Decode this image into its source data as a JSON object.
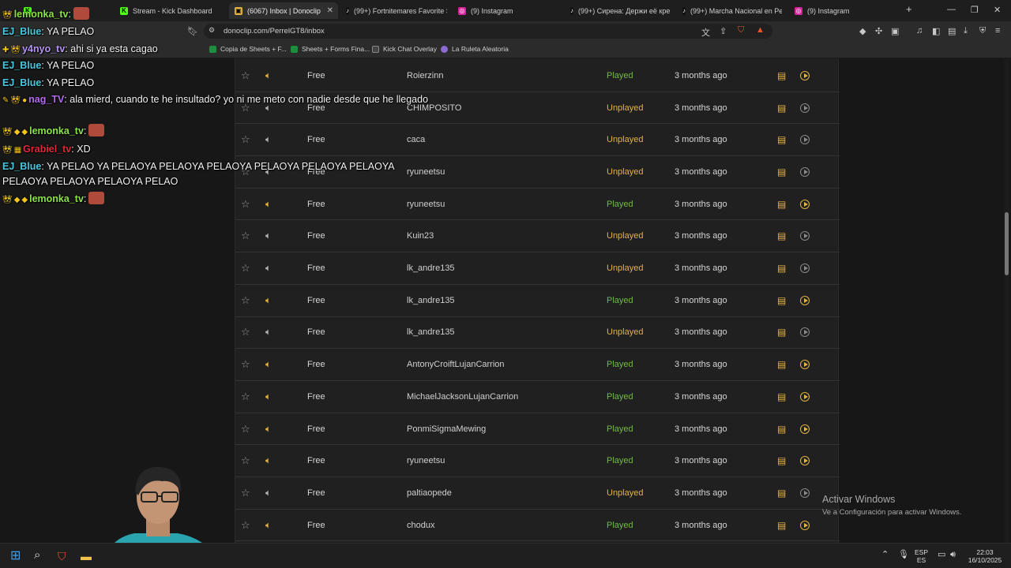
{
  "tabs": [
    {
      "title": "",
      "icon": "kick-icon"
    },
    {
      "title": "Stream - Kick Dashboard",
      "icon": "kick-icon"
    },
    {
      "title": "(6067) Inbox | Donoclip",
      "icon": "donoclip-icon",
      "active": true
    },
    {
      "title": "(99+) Fortnitemares Favorite Sk",
      "icon": "tiktok-icon"
    },
    {
      "title": "(9) Instagram",
      "icon": "instagram-icon"
    },
    {
      "title": "(99+) Сирена: Держи её крепк",
      "icon": "tiktok-icon"
    },
    {
      "title": "(99+) Marcha Nacional en Perú",
      "icon": "tiktok-icon"
    },
    {
      "title": "(9) Instagram",
      "icon": "instagram-icon"
    }
  ],
  "toolbar": {
    "url": "donoclip.com/PerrelGT8/inbox"
  },
  "bookmarks": [
    {
      "label": "Copia de Sheets + F...",
      "color": "#1e8e3e"
    },
    {
      "label": "Sheets + Forms Fina...",
      "color": "#1e8e3e"
    },
    {
      "label": "Kick Chat Overlay",
      "color": "#2a2a2a"
    },
    {
      "label": "La Ruleta Aleatoria",
      "color": "#8c6bd1"
    }
  ],
  "inbox": {
    "rows": [
      {
        "tier": "Free",
        "sender": "Roierzinn",
        "status": "Played",
        "when": "3 months ago"
      },
      {
        "tier": "Free",
        "sender": "CHIMPOSITO",
        "status": "Unplayed",
        "when": "3 months ago"
      },
      {
        "tier": "Free",
        "sender": "caca",
        "status": "Unplayed",
        "when": "3 months ago"
      },
      {
        "tier": "Free",
        "sender": "ryuneetsu",
        "status": "Unplayed",
        "when": "3 months ago"
      },
      {
        "tier": "Free",
        "sender": "ryuneetsu",
        "status": "Played",
        "when": "3 months ago"
      },
      {
        "tier": "Free",
        "sender": "Kuin23",
        "status": "Unplayed",
        "when": "3 months ago"
      },
      {
        "tier": "Free",
        "sender": "lk_andre135",
        "status": "Unplayed",
        "when": "3 months ago"
      },
      {
        "tier": "Free",
        "sender": "lk_andre135",
        "status": "Played",
        "when": "3 months ago"
      },
      {
        "tier": "Free",
        "sender": "lk_andre135",
        "status": "Unplayed",
        "when": "3 months ago"
      },
      {
        "tier": "Free",
        "sender": "AntonyCroiftLujanCarrion",
        "status": "Played",
        "when": "3 months ago"
      },
      {
        "tier": "Free",
        "sender": "MichaelJacksonLujanCarrion",
        "status": "Played",
        "when": "3 months ago"
      },
      {
        "tier": "Free",
        "sender": "PonmiSigmaMewing",
        "status": "Played",
        "when": "3 months ago"
      },
      {
        "tier": "Free",
        "sender": "ryuneetsu",
        "status": "Played",
        "when": "3 months ago"
      },
      {
        "tier": "Free",
        "sender": "paltiaopede",
        "status": "Unplayed",
        "when": "3 months ago"
      },
      {
        "tier": "Free",
        "sender": "chodux",
        "status": "Played",
        "when": "3 months ago"
      }
    ]
  },
  "chat": [
    {
      "user": "lemonka_tv",
      "user_color": "#8be24a",
      "text": ":",
      "emote": true
    },
    {
      "user": "EJ_Blue",
      "user_color": "#46c9e0",
      "text": ": YA PELAO"
    },
    {
      "user": "y4nyo_tv",
      "user_color": "#b794f6",
      "text": ": ahi si ya esta cagao"
    },
    {
      "user": "EJ_Blue",
      "user_color": "#46c9e0",
      "text": ": YA PELAO"
    },
    {
      "user": "EJ_Blue",
      "user_color": "#46c9e0",
      "text": ": YA PELAO"
    },
    {
      "user": "nag_TV",
      "user_color": "#b36cf0",
      "text": ": ala mierd, cuando te he insultado? yo ni me meto con nadie desde que he llegado"
    },
    {
      "user": "lemonka_tv",
      "user_color": "#8be24a",
      "text": ":",
      "emote": true
    },
    {
      "user": "Grabiel_tv",
      "user_color": "#e0283a",
      "text": ": XD"
    },
    {
      "user": "EJ_Blue",
      "user_color": "#46c9e0",
      "text": ": YA PELAO YA PELAOYA PELAOYA PELAOYA PELAOYA PELAOYA PELAOYA PELAOYA PELAOYA PELAOYA PELAO"
    },
    {
      "user": "lemonka_tv",
      "user_color": "#8be24a",
      "text": ":",
      "emote": true
    }
  ],
  "watermark": {
    "line1": "Activar Windows",
    "line2": "Ve a Configuración para activar Windows."
  },
  "taskbar": {
    "lang_top": "ESP",
    "lang_bottom": "ES",
    "time": "22:03",
    "date": "16/10/2025"
  },
  "colors": {
    "played": "#72b84a",
    "unplayed": "#e3b341",
    "panel": "#202020"
  }
}
